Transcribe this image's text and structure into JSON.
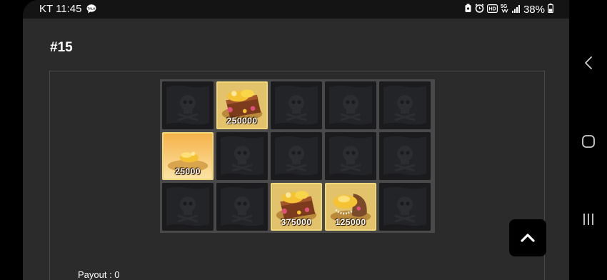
{
  "status_bar": {
    "carrier_time": "KT 11:45",
    "talk_badge": "TALK",
    "network_label": "5G",
    "hd_label": "HD",
    "battery": "38%"
  },
  "round": {
    "title": "#15"
  },
  "board": {
    "rows": [
      [
        {
          "type": "empty"
        },
        {
          "type": "treasure-chest",
          "amount": "250000"
        },
        {
          "type": "empty"
        },
        {
          "type": "empty"
        },
        {
          "type": "empty"
        }
      ],
      [
        {
          "type": "gold-pile",
          "amount": "25000"
        },
        {
          "type": "empty"
        },
        {
          "type": "empty"
        },
        {
          "type": "empty"
        },
        {
          "type": "empty"
        }
      ],
      [
        {
          "type": "empty"
        },
        {
          "type": "empty"
        },
        {
          "type": "treasure-chest",
          "amount": "375000"
        },
        {
          "type": "gold-sack",
          "amount": "125000"
        },
        {
          "type": "empty"
        }
      ]
    ]
  },
  "payout": {
    "label": "Payout : 0"
  },
  "icons": {
    "scroll_top": "chevron-up-icon",
    "nav_back": "chevron-left-icon",
    "nav_home": "rounded-square-icon",
    "nav_recents": "three-bars-icon"
  },
  "colors": {
    "app_background": "#2b2b2b",
    "tile_empty": "#1b1b1d",
    "tile_prize": "#d7b04a",
    "tile_prize_border": "#f2d77a"
  }
}
